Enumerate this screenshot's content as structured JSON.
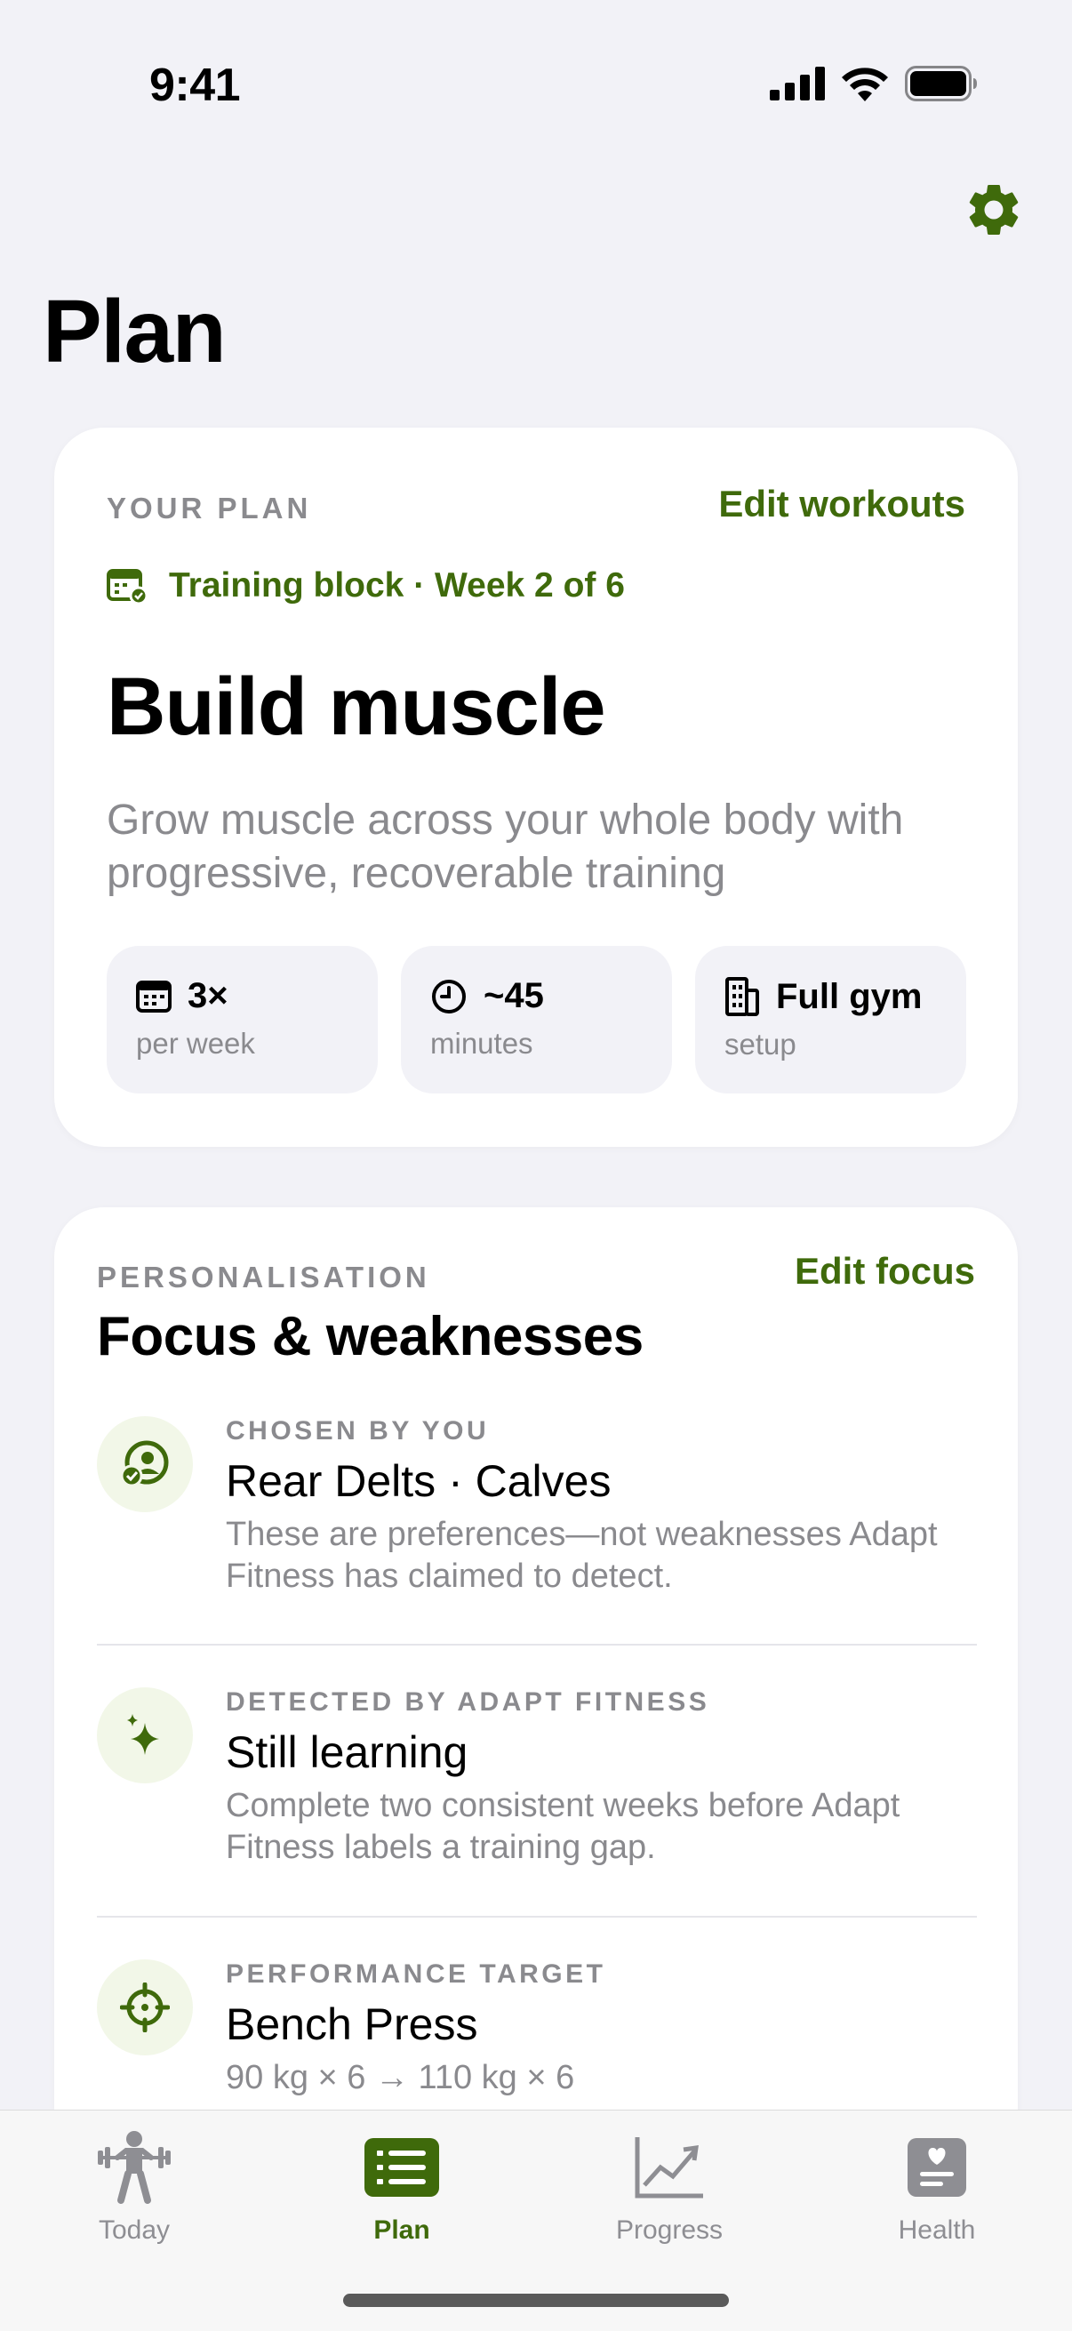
{
  "status_bar": {
    "time": "9:41"
  },
  "page": {
    "title": "Plan"
  },
  "plan_card": {
    "eyebrow": "YOUR PLAN",
    "edit_label": "Edit workouts",
    "block_label": "Training block · Week 2 of 6",
    "title": "Build muscle",
    "description": "Grow muscle across your whole body with progressive, recoverable training",
    "stats": [
      {
        "value": "3×",
        "label": "per week",
        "icon": "calendar-icon"
      },
      {
        "value": "~45",
        "label": "minutes",
        "icon": "clock-icon"
      },
      {
        "value": "Full gym",
        "label": "setup",
        "icon": "building-icon"
      }
    ]
  },
  "focus_card": {
    "eyebrow": "PERSONALISATION",
    "edit_label": "Edit focus",
    "title": "Focus & weaknesses",
    "items": [
      {
        "eyebrow": "CHOSEN BY YOU",
        "title": "Rear Delts · Calves",
        "description": "These are preferences—not weaknesses Adapt Fitness has claimed to detect.",
        "icon": "person-check-icon"
      },
      {
        "eyebrow": "DETECTED BY ADAPT FITNESS",
        "title": "Still learning",
        "description": "Complete two consistent weeks before Adapt Fitness labels a training gap.",
        "icon": "sparkles-icon"
      },
      {
        "eyebrow": "PERFORMANCE TARGET",
        "title": "Bench Press",
        "description": "90 kg × 6 → 110 kg × 6",
        "icon": "target-icon"
      }
    ]
  },
  "tab_bar": {
    "tabs": [
      {
        "label": "Today",
        "icon": "weightlifter-icon",
        "active": false
      },
      {
        "label": "Plan",
        "icon": "list-icon",
        "active": true
      },
      {
        "label": "Progress",
        "icon": "chart-icon",
        "active": false
      },
      {
        "label": "Health",
        "icon": "health-icon",
        "active": false
      }
    ]
  },
  "colors": {
    "accent": "#3f6a0b",
    "background": "#f2f2f7",
    "secondary_text": "#8a8a8e",
    "icon_tint_bg": "#f2f7e8"
  }
}
